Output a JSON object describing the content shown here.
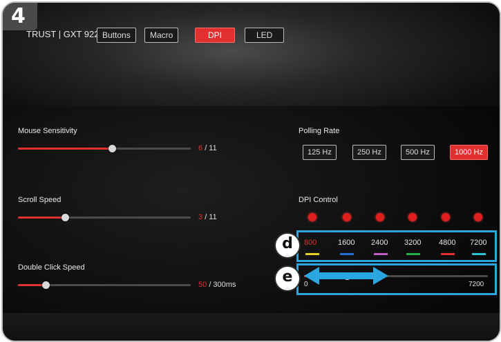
{
  "step_badge": "4",
  "brand": "TRUST | GXT 922",
  "tabs": [
    {
      "label": "Buttons",
      "active": false
    },
    {
      "label": "Macro",
      "active": false
    },
    {
      "label": "DPI",
      "active": true
    },
    {
      "label": "LED",
      "active": false
    }
  ],
  "mouse_sensitivity": {
    "label": "Mouse Sensitivity",
    "value": "6",
    "max": "/ 11"
  },
  "scroll_speed": {
    "label": "Scroll Speed",
    "value": "3",
    "max": "/ 11"
  },
  "double_click_speed": {
    "label": "Double Click Speed",
    "value": "50",
    "max": "/ 300ms"
  },
  "polling_rate": {
    "label": "Polling Rate",
    "options": [
      {
        "label": "125 Hz",
        "active": false
      },
      {
        "label": "250 Hz",
        "active": false
      },
      {
        "label": "500 Hz",
        "active": false
      },
      {
        "label": "1000 Hz",
        "active": true
      }
    ]
  },
  "dpi_control": {
    "label": "DPI Control",
    "levels": [
      {
        "value": "800",
        "color": "#e6d21e",
        "active": true
      },
      {
        "value": "1600",
        "color": "#1f6fd6",
        "active": false
      },
      {
        "value": "2400",
        "color": "#c65cc6",
        "active": false
      },
      {
        "value": "3200",
        "color": "#20b04a",
        "active": false
      },
      {
        "value": "4800",
        "color": "#e03030",
        "active": false
      },
      {
        "value": "7200",
        "color": "#29c4d4",
        "active": false
      }
    ],
    "range_min": "0",
    "range_max": "7200"
  },
  "callouts": {
    "d": "d",
    "e": "e"
  },
  "colors": {
    "accent": "#e03030",
    "highlight": "#2ba6e0"
  }
}
